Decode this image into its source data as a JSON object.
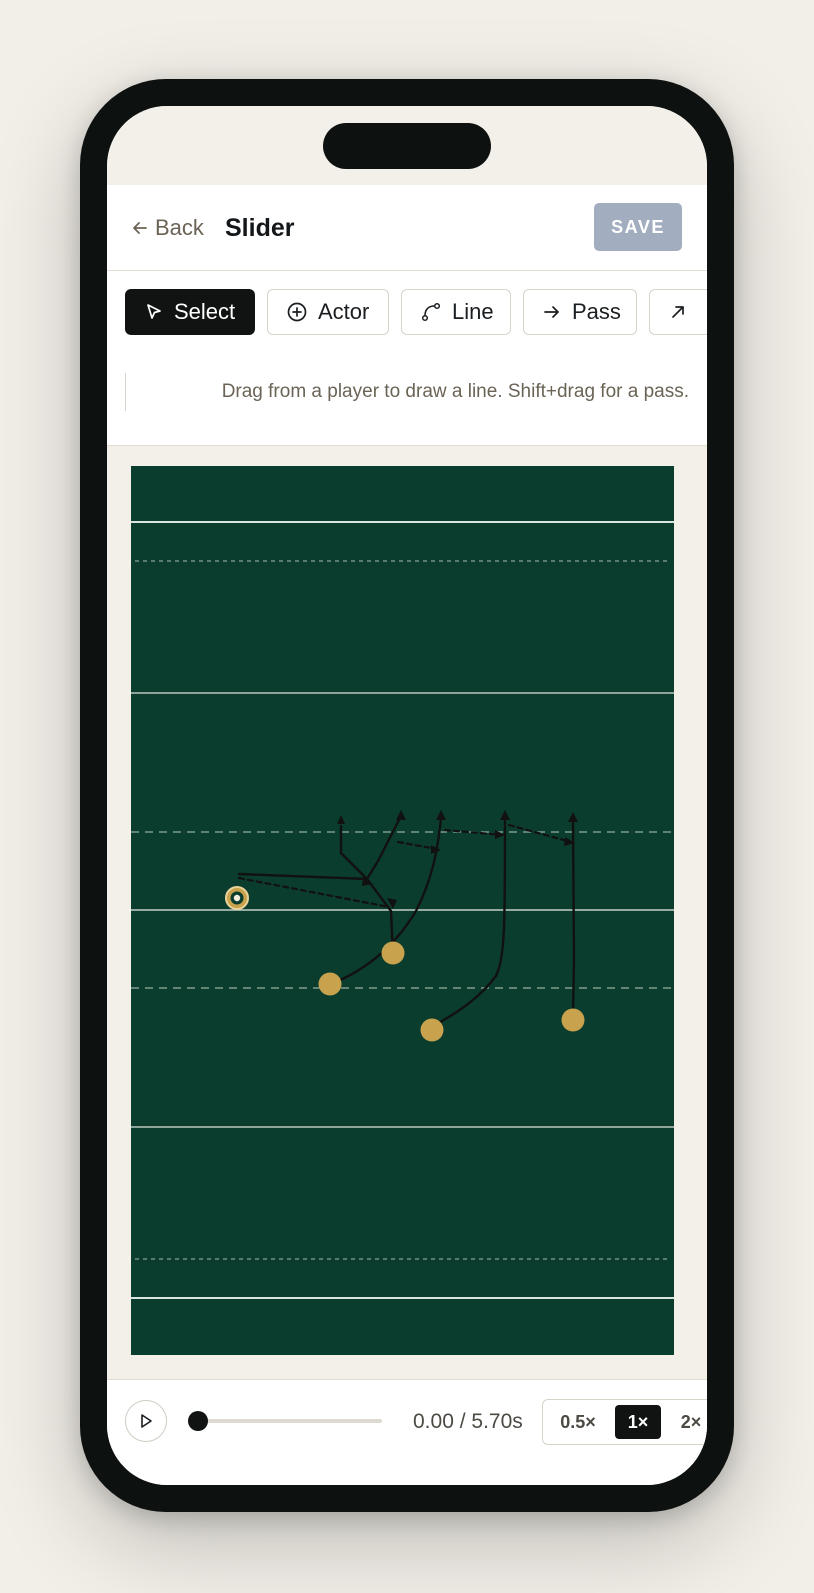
{
  "header": {
    "back_label": "Back",
    "title": "Slider",
    "save_label": "SAVE"
  },
  "toolbar": {
    "tools": [
      {
        "label": "Select",
        "icon": "cursor-arrow-icon",
        "active": true
      },
      {
        "label": "Actor",
        "icon": "plus-circle-icon",
        "active": false
      },
      {
        "label": "Line",
        "icon": "curve-line-icon",
        "active": false
      },
      {
        "label": "Pass",
        "icon": "arrow-right-icon",
        "active": false
      },
      {
        "label": "",
        "icon": "arrow-up-right-icon",
        "active": false
      }
    ],
    "hint": "Drag from a player to draw a line. Shift+drag for a pass."
  },
  "field": {
    "colors": {
      "turf": "#0b3d2e",
      "lines": "#b9c8bf",
      "player": "#c9a24e",
      "route": "#111111"
    }
  },
  "playback": {
    "current": "0.00",
    "duration": "5.70s",
    "separator": " / ",
    "progress": 0,
    "speeds": [
      {
        "label": "0.5×",
        "active": false
      },
      {
        "label": "1×",
        "active": true
      },
      {
        "label": "2×",
        "active": false
      }
    ]
  }
}
